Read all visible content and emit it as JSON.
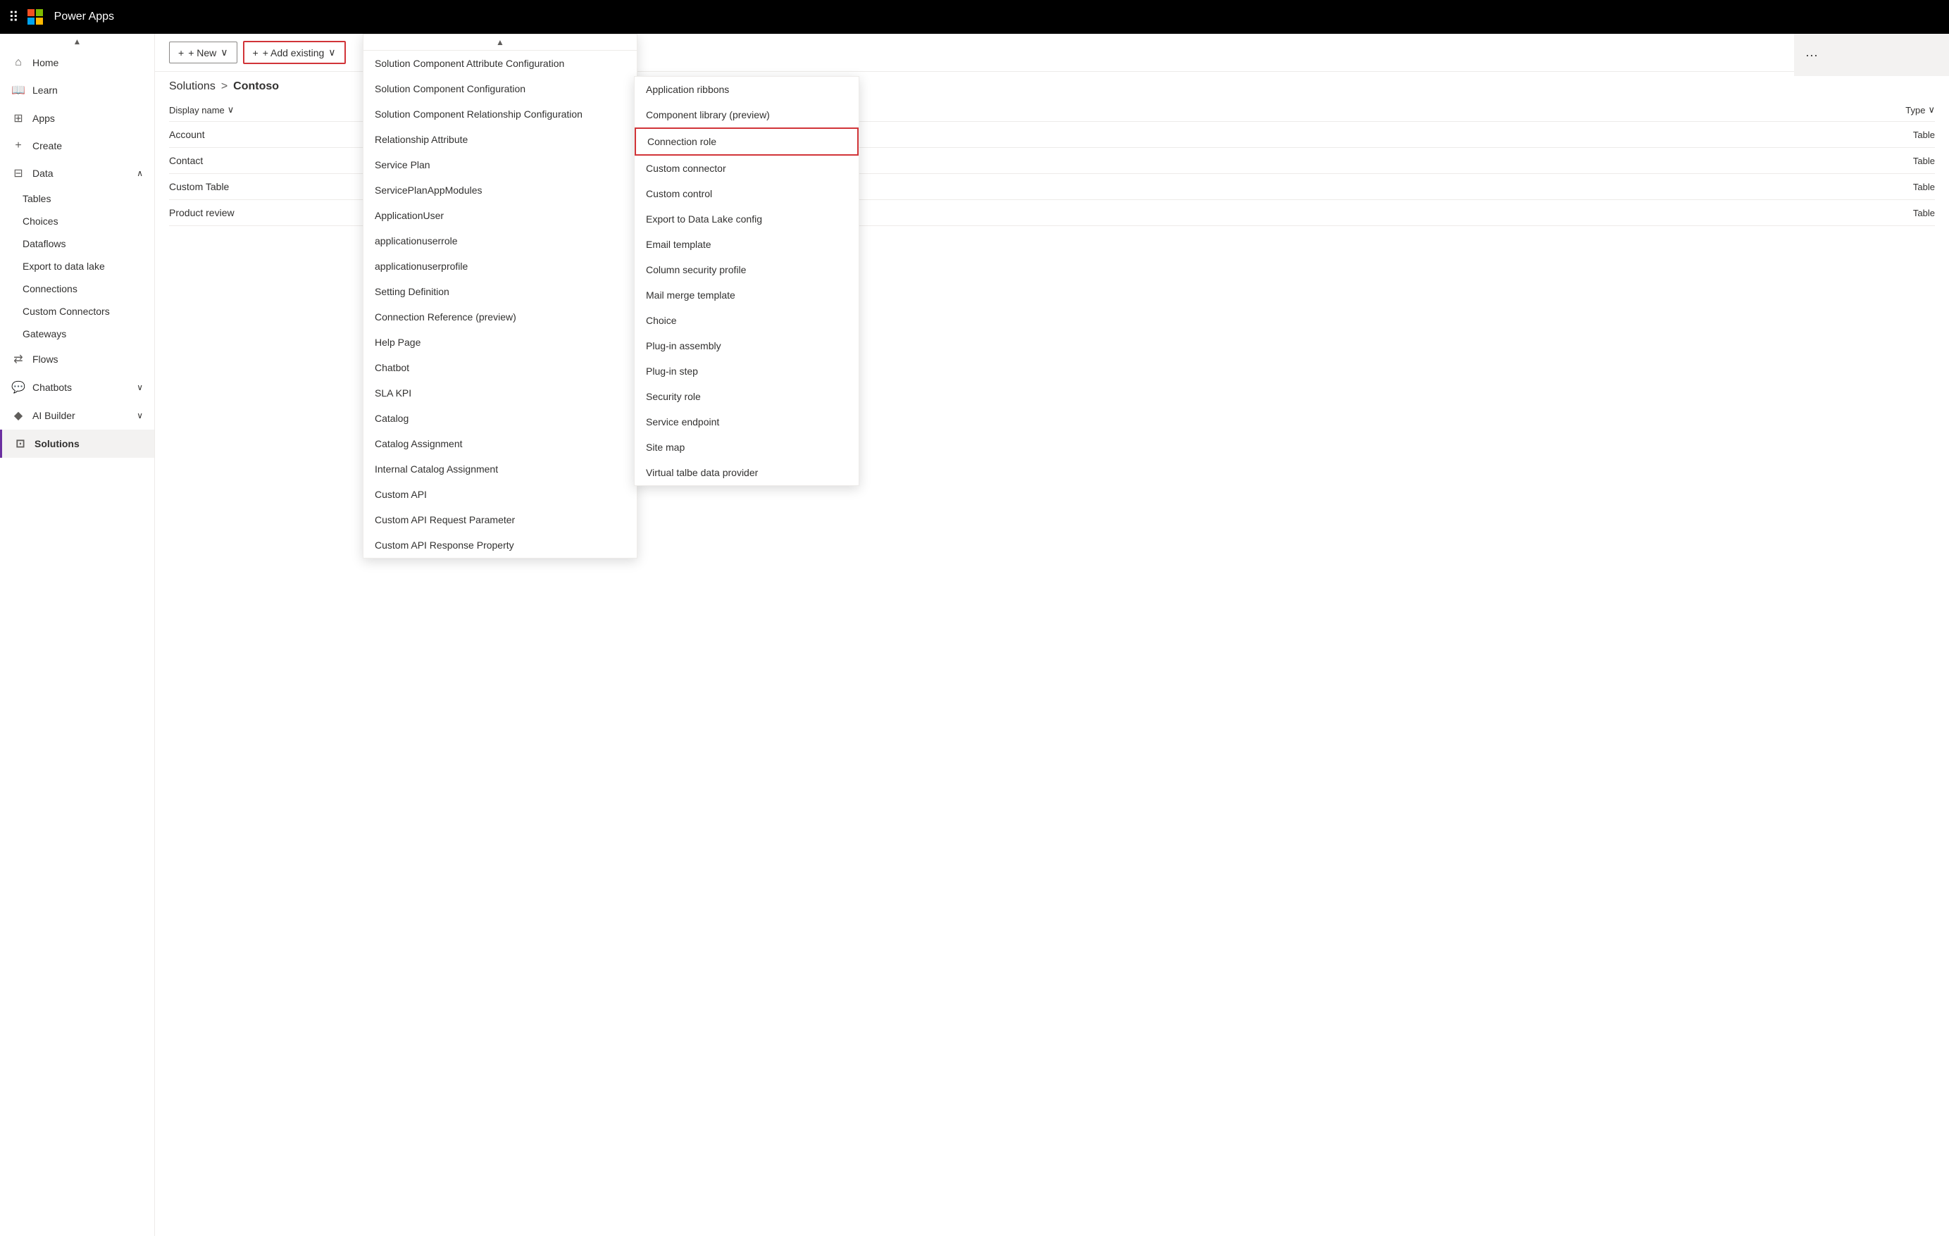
{
  "topbar": {
    "title": "Power Apps"
  },
  "sidebar": {
    "items": [
      {
        "id": "home",
        "label": "Home",
        "icon": "⌂"
      },
      {
        "id": "learn",
        "label": "Learn",
        "icon": "📖"
      },
      {
        "id": "apps",
        "label": "Apps",
        "icon": "⊞"
      },
      {
        "id": "create",
        "label": "Create",
        "icon": "+"
      },
      {
        "id": "data",
        "label": "Data",
        "icon": "⊟",
        "expanded": true
      },
      {
        "id": "tables",
        "label": "Tables",
        "sub": true
      },
      {
        "id": "choices",
        "label": "Choices",
        "sub": true
      },
      {
        "id": "dataflows",
        "label": "Dataflows",
        "sub": true
      },
      {
        "id": "export-data-lake",
        "label": "Export to data lake",
        "sub": true
      },
      {
        "id": "connections",
        "label": "Connections",
        "sub": true
      },
      {
        "id": "custom-connectors",
        "label": "Custom Connectors",
        "sub": true
      },
      {
        "id": "gateways",
        "label": "Gateways",
        "sub": true
      },
      {
        "id": "flows",
        "label": "Flows",
        "icon": "⇄"
      },
      {
        "id": "chatbots",
        "label": "Chatbots",
        "icon": "💬",
        "chevron": "∨"
      },
      {
        "id": "ai-builder",
        "label": "AI Builder",
        "icon": "◆",
        "chevron": "∨"
      },
      {
        "id": "solutions",
        "label": "Solutions",
        "icon": "⊡",
        "active": true
      }
    ]
  },
  "toolbar": {
    "new_label": "+ New",
    "add_existing_label": "+ Add existing",
    "new_chevron": "∨",
    "add_existing_chevron": "∨"
  },
  "breadcrumb": {
    "solutions_label": "Solutions",
    "separator": ">",
    "current": "Contoso"
  },
  "table_header": {
    "display_name_label": "Display name",
    "type_label": "Type"
  },
  "table_rows": [
    {
      "name": "Account",
      "type": "Table"
    },
    {
      "name": "Contact",
      "type": "Table"
    },
    {
      "name": "Custom Table",
      "type": "Table"
    },
    {
      "name": "Product review",
      "type": "Table"
    }
  ],
  "dropdown1": {
    "scroll_indicator": "▲",
    "items": [
      "Solution Component Attribute Configuration",
      "Solution Component Configuration",
      "Solution Component Relationship Configuration",
      "Relationship Attribute",
      "Service Plan",
      "ServicePlanAppModules",
      "ApplicationUser",
      "applicationuserrole",
      "applicationuserprofile",
      "Setting Definition",
      "Connection Reference (preview)",
      "Help Page",
      "Chatbot",
      "SLA KPI",
      "Catalog",
      "Catalog Assignment",
      "Internal Catalog Assignment",
      "Custom API",
      "Custom API Request Parameter",
      "Custom API Response Property"
    ]
  },
  "dropdown2": {
    "items": [
      "Application ribbons",
      "Component library (preview)",
      "Connection role",
      "Custom connector",
      "Custom control",
      "Export to Data Lake config",
      "Email template",
      "Column security profile",
      "Mail merge template",
      "Choice",
      "Plug-in assembly",
      "Plug-in step",
      "Security role",
      "Service endpoint",
      "Site map",
      "Virtual talbe data provider"
    ],
    "highlighted_item": "Connection role"
  },
  "right_panel": {
    "more_icon": "···"
  },
  "search_box_bg": "#edebe9"
}
